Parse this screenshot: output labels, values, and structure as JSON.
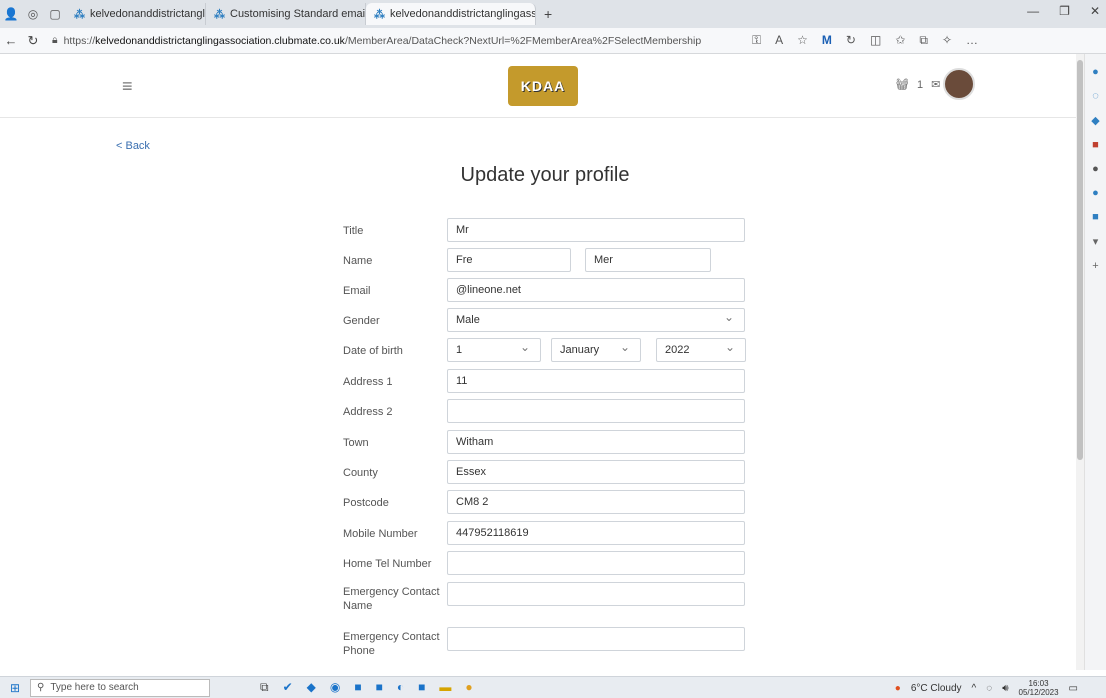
{
  "browser": {
    "tabs": [
      {
        "title": "kelvedonanddistrictanglingassoc",
        "active": false
      },
      {
        "title": "Customising Standard email tem",
        "active": false
      },
      {
        "title": "kelvedonanddistrictanglingassoc",
        "active": true
      }
    ],
    "url_prefix": "https://",
    "url_host": "kelvedonanddistrictanglingassociation.clubmate.co.uk",
    "url_path": "/MemberArea/DataCheck?NextUrl=%2FMemberArea%2FSelectMembership"
  },
  "header": {
    "logo_text": "KDAA",
    "basket_count": "1"
  },
  "page": {
    "back_label": "< Back",
    "title": "Update your profile"
  },
  "form": {
    "title_label": "Title",
    "title_value": "Mr",
    "name_label": "Name",
    "first_name": "Fre",
    "last_name": "Mer",
    "email_label": "Email",
    "email_value": "@lineone.net",
    "gender_label": "Gender",
    "gender_value": "Male",
    "dob_label": "Date of birth",
    "dob_day": "1",
    "dob_month": "January",
    "dob_year": "2022",
    "address1_label": "Address 1",
    "address1_value": "11",
    "address2_label": "Address 2",
    "address2_value": "",
    "town_label": "Town",
    "town_value": "Witham",
    "county_label": "County",
    "county_value": "Essex",
    "postcode_label": "Postcode",
    "postcode_value": "CM8 2",
    "mobile_label": "Mobile Number",
    "mobile_value": "447952118619",
    "hometel_label": "Home Tel Number",
    "hometel_value": "",
    "emname_label": "Emergency Contact Name",
    "emname_value": "",
    "emphone_label": "Emergency Contact Phone",
    "emphone_value": ""
  },
  "taskbar": {
    "search_placeholder": "Type here to search",
    "weather": "6°C  Cloudy",
    "time": "16:03",
    "date": "05/12/2023"
  }
}
